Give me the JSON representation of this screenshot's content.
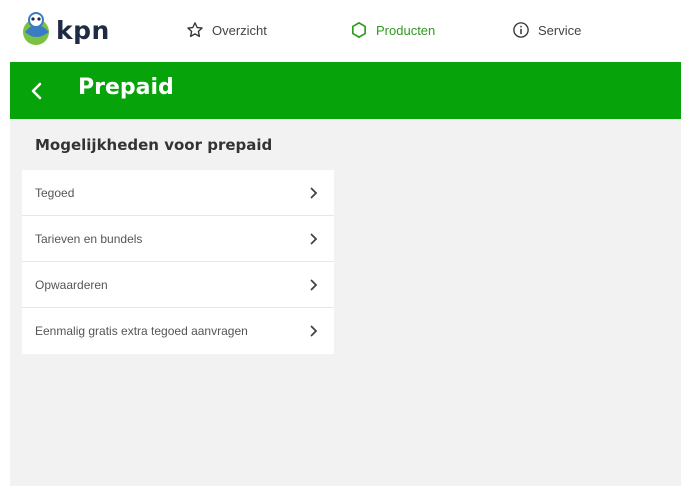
{
  "header": {
    "logo_text": "kpn",
    "nav": [
      {
        "label": "Overzicht",
        "icon": "star-icon"
      },
      {
        "label": "Producten",
        "icon": "hexagon-icon",
        "active": true
      },
      {
        "label": "Service",
        "icon": "info-icon"
      }
    ]
  },
  "page": {
    "title": "Prepaid",
    "back_icon": "chevron-left-icon"
  },
  "section": {
    "title": "Mogelijkheden voor prepaid",
    "items": [
      {
        "label": "Tegoed"
      },
      {
        "label": "Tarieven en bundels"
      },
      {
        "label": "Opwaarderen"
      },
      {
        "label": "Eenmalig gratis extra tegoed aanvragen"
      }
    ]
  },
  "colors": {
    "brand_green": "#06a30a",
    "nav_active": "#2e9a1e",
    "background": "#f2f2f2"
  }
}
